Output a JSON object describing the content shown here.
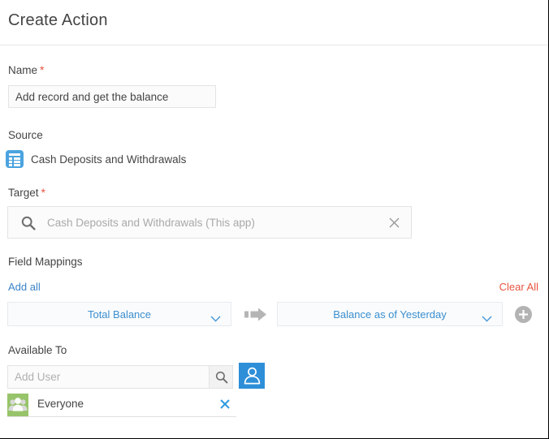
{
  "header": {
    "title": "Create Action"
  },
  "form": {
    "name": {
      "label": "Name",
      "required_marker": "*",
      "value": "Add record and get the balance",
      "placeholder": "Name"
    },
    "source": {
      "label": "Source",
      "icon": "app-list-icon",
      "value": "Cash Deposits and Withdrawals"
    },
    "target": {
      "label": "Target",
      "required_marker": "*",
      "search_icon": "search-icon",
      "value": "Cash Deposits and Withdrawals (This app)",
      "clear_icon": "close-icon"
    },
    "field_mappings": {
      "label": "Field Mappings",
      "add_all_label": "Add all",
      "clear_all_label": "Clear All",
      "arrow_icon": "arrow-right-icon",
      "add_row_icon": "plus-circle-icon",
      "rows": [
        {
          "source_field": "Total Balance",
          "target_field": "Balance as of Yesterday",
          "source_chevron": "chevron-down-icon",
          "target_chevron": "chevron-down-icon"
        }
      ]
    },
    "available_to": {
      "label": "Available To",
      "input_value": "",
      "input_placeholder": "Add User",
      "search_icon": "search-icon",
      "pick_user_icon": "user-icon",
      "entries": [
        {
          "icon": "group-icon",
          "name": "Everyone",
          "remove_icon": "close-icon"
        }
      ]
    }
  },
  "colors": {
    "accent_blue": "#3a8fd0",
    "link_blue": "#3a84c9",
    "danger_red": "#e8543f",
    "source_icon_blue": "#4aa3df",
    "group_icon_green": "#97c46a",
    "user_button_blue": "#2e8fd8",
    "arrow_gray": "#b5b5b5"
  }
}
